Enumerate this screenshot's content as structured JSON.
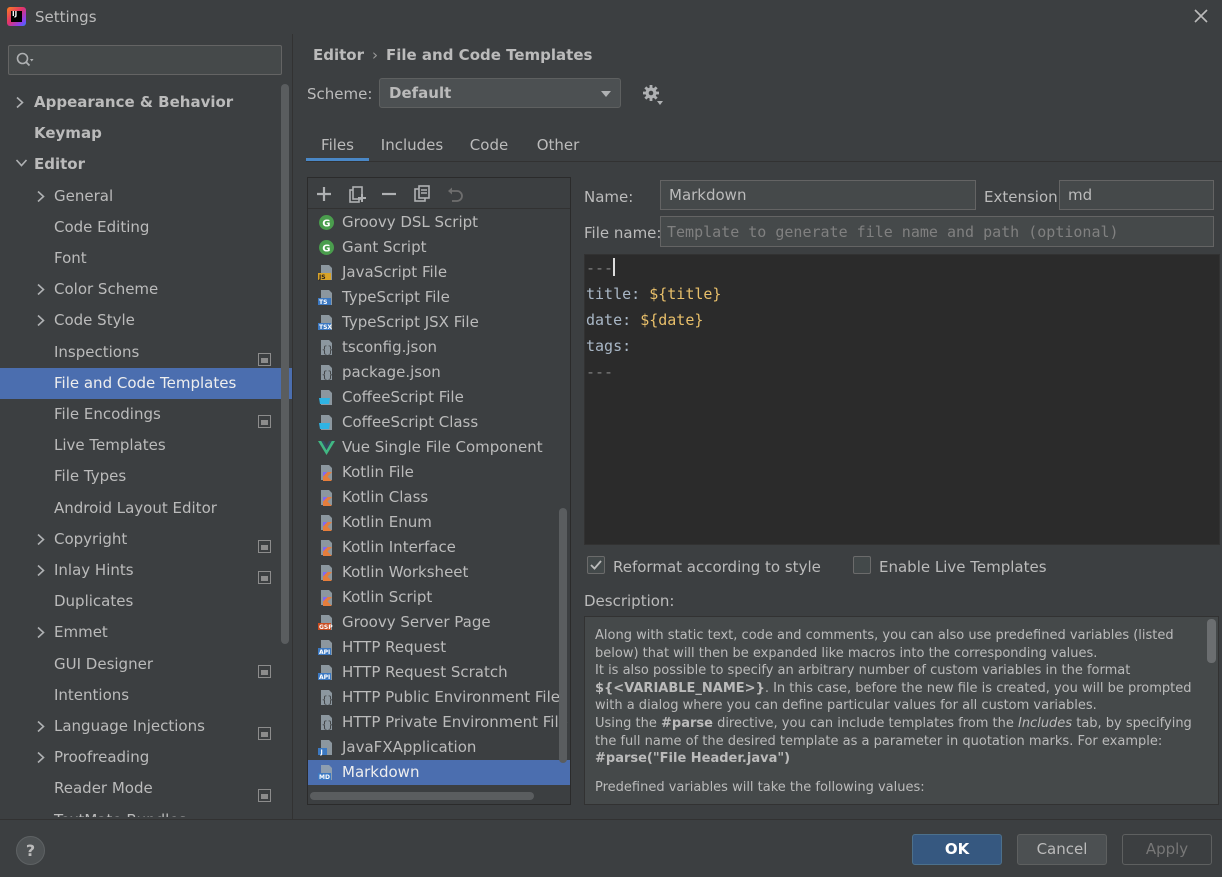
{
  "window": {
    "title": "Settings"
  },
  "search": {
    "placeholder": ""
  },
  "sidebar": {
    "items": [
      {
        "label": "Appearance & Behavior",
        "bold": true,
        "level": 0,
        "chevron": "right",
        "project": false
      },
      {
        "label": "Keymap",
        "bold": true,
        "level": 0,
        "chevron": "none",
        "project": false
      },
      {
        "label": "Editor",
        "bold": true,
        "level": 0,
        "chevron": "down",
        "project": false
      },
      {
        "label": "General",
        "bold": false,
        "level": 1,
        "chevron": "right",
        "project": false
      },
      {
        "label": "Code Editing",
        "bold": false,
        "level": 1,
        "chevron": "none",
        "project": false
      },
      {
        "label": "Font",
        "bold": false,
        "level": 1,
        "chevron": "none",
        "project": false
      },
      {
        "label": "Color Scheme",
        "bold": false,
        "level": 1,
        "chevron": "right",
        "project": false
      },
      {
        "label": "Code Style",
        "bold": false,
        "level": 1,
        "chevron": "right",
        "project": false
      },
      {
        "label": "Inspections",
        "bold": false,
        "level": 1,
        "chevron": "none",
        "project": true
      },
      {
        "label": "File and Code Templates",
        "bold": false,
        "level": 1,
        "chevron": "none",
        "project": false,
        "selected": true
      },
      {
        "label": "File Encodings",
        "bold": false,
        "level": 1,
        "chevron": "none",
        "project": true
      },
      {
        "label": "Live Templates",
        "bold": false,
        "level": 1,
        "chevron": "none",
        "project": false
      },
      {
        "label": "File Types",
        "bold": false,
        "level": 1,
        "chevron": "none",
        "project": false
      },
      {
        "label": "Android Layout Editor",
        "bold": false,
        "level": 1,
        "chevron": "none",
        "project": false
      },
      {
        "label": "Copyright",
        "bold": false,
        "level": 1,
        "chevron": "right",
        "project": true
      },
      {
        "label": "Inlay Hints",
        "bold": false,
        "level": 1,
        "chevron": "right",
        "project": true
      },
      {
        "label": "Duplicates",
        "bold": false,
        "level": 1,
        "chevron": "none",
        "project": false
      },
      {
        "label": "Emmet",
        "bold": false,
        "level": 1,
        "chevron": "right",
        "project": false
      },
      {
        "label": "GUI Designer",
        "bold": false,
        "level": 1,
        "chevron": "none",
        "project": true
      },
      {
        "label": "Intentions",
        "bold": false,
        "level": 1,
        "chevron": "none",
        "project": false
      },
      {
        "label": "Language Injections",
        "bold": false,
        "level": 1,
        "chevron": "right",
        "project": true
      },
      {
        "label": "Proofreading",
        "bold": false,
        "level": 1,
        "chevron": "right",
        "project": false
      },
      {
        "label": "Reader Mode",
        "bold": false,
        "level": 1,
        "chevron": "none",
        "project": true
      },
      {
        "label": "TextMate Bundles",
        "bold": false,
        "level": 1,
        "chevron": "none",
        "project": false
      }
    ]
  },
  "breadcrumb": {
    "parent": "Editor",
    "separator": "›",
    "current": "File and Code Templates"
  },
  "scheme": {
    "label": "Scheme:",
    "value": "Default"
  },
  "tabs": [
    {
      "label": "Files",
      "active": true
    },
    {
      "label": "Includes",
      "active": false
    },
    {
      "label": "Code",
      "active": false
    },
    {
      "label": "Other",
      "active": false
    }
  ],
  "toolbar": {
    "buttons": [
      "add-icon",
      "add-child-icon",
      "remove-icon",
      "copy-icon",
      "reset-icon"
    ]
  },
  "templates": [
    {
      "label": "Groovy DSL Script",
      "icon": "groovy"
    },
    {
      "label": "Gant Script",
      "icon": "groovy"
    },
    {
      "label": "JavaScript File",
      "icon": "js"
    },
    {
      "label": "TypeScript File",
      "icon": "ts"
    },
    {
      "label": "TypeScript JSX File",
      "icon": "tsx"
    },
    {
      "label": "tsconfig.json",
      "icon": "json"
    },
    {
      "label": "package.json",
      "icon": "json"
    },
    {
      "label": "CoffeeScript File",
      "icon": "coffee"
    },
    {
      "label": "CoffeeScript Class",
      "icon": "coffee"
    },
    {
      "label": "Vue Single File Component",
      "icon": "vue"
    },
    {
      "label": "Kotlin File",
      "icon": "kotlin"
    },
    {
      "label": "Kotlin Class",
      "icon": "kotlin"
    },
    {
      "label": "Kotlin Enum",
      "icon": "kotlin"
    },
    {
      "label": "Kotlin Interface",
      "icon": "kotlin"
    },
    {
      "label": "Kotlin Worksheet",
      "icon": "kotlin"
    },
    {
      "label": "Kotlin Script",
      "icon": "kotlin"
    },
    {
      "label": "Groovy Server Page",
      "icon": "gsp"
    },
    {
      "label": "HTTP Request",
      "icon": "api"
    },
    {
      "label": "HTTP Request Scratch",
      "icon": "api"
    },
    {
      "label": "HTTP Public Environment File",
      "icon": "json"
    },
    {
      "label": "HTTP Private Environment File",
      "icon": "json"
    },
    {
      "label": "JavaFXApplication",
      "icon": "java"
    },
    {
      "label": "Markdown",
      "icon": "md",
      "selected": true
    }
  ],
  "form": {
    "name_label": "Name:",
    "name_value": "Markdown",
    "extension_label": "Extension:",
    "extension_value": "md",
    "filename_label": "File name:",
    "filename_placeholder": "Template to generate file name and path (optional)"
  },
  "editor": {
    "lines": [
      {
        "text": "---",
        "dim": true,
        "caret": true
      },
      {
        "prefix": "title: ",
        "var": "${title}"
      },
      {
        "prefix": "date: ",
        "var": "${date}"
      },
      {
        "prefix": "tags:"
      },
      {
        "text": "---",
        "dim": true
      }
    ]
  },
  "options": {
    "reformat_label": "Reformat according to style",
    "reformat_checked": true,
    "live_templates_label": "Enable Live Templates",
    "live_templates_checked": false
  },
  "description": {
    "label": "Description:",
    "p1": "Along with static text, code and comments, you can also use predefined variables (listed below) that will then be expanded like macros into the corresponding values.",
    "p2_a": "It is also possible to specify an arbitrary number of custom variables in the format ",
    "p2_code": "${<VARIABLE_NAME>}",
    "p2_b": ". In this case, before the new file is created, you will be prompted with a dialog where you can define particular values for all custom variables.",
    "p3_a": "Using the ",
    "p3_code": "#parse",
    "p3_b": " directive, you can include templates from the ",
    "p3_italic": "Includes",
    "p3_c": " tab, by specifying the full name of the desired template as a parameter in quotation marks. For example:",
    "p3_example": "#parse(\"File Header.java\")",
    "p4": "Predefined variables will take the following values:"
  },
  "buttons": {
    "help": "?",
    "ok": "OK",
    "cancel": "Cancel",
    "apply": "Apply"
  }
}
